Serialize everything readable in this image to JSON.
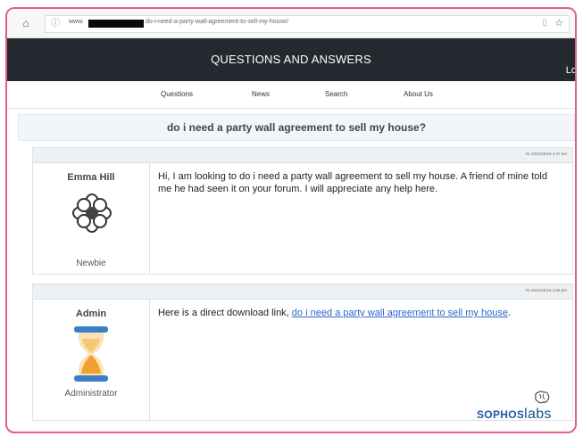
{
  "browser": {
    "url_prefix": "www.",
    "url_path": "do-i-need-a-party-wall-agreement-to-sell-my-house/"
  },
  "site": {
    "title": "QUESTIONS AND ANSWERS",
    "login_text": "Lo",
    "nav": [
      "Questions",
      "News",
      "Search",
      "About Us"
    ]
  },
  "thread": {
    "title": "do i need a party wall agreement to sell my house?"
  },
  "posts": [
    {
      "meta": "#1 2021/02/16 4:47 am",
      "username": "Emma Hill",
      "role": "Newbie",
      "message": "Hi, I am looking to do i need a party wall agreement to sell my house. A friend of mine told me he had seen it on your forum. I will appreciate any help here."
    },
    {
      "meta": "#2 2021/02/16 4:56 pm",
      "username": "Admin",
      "role": "Administrator",
      "message_prefix": "Here is a direct download link, ",
      "link_text": "do i need a party wall agreement to sell my house",
      "message_suffix": "."
    }
  ],
  "logo": {
    "brand": "SOPHOS",
    "product": "labs"
  },
  "colors": {
    "frame_border": "#e0608a",
    "header_bg": "#23292e",
    "link": "#2a68c8",
    "hourglass_cap": "#3c7fc4",
    "hourglass_sand": "#f0a030"
  },
  "icons": {
    "home": "home-icon",
    "info": "info-icon",
    "reader": "reader-view-icon",
    "bookmark": "star-icon",
    "avatar_newbie": "flower-icon",
    "avatar_admin": "hourglass-icon"
  }
}
